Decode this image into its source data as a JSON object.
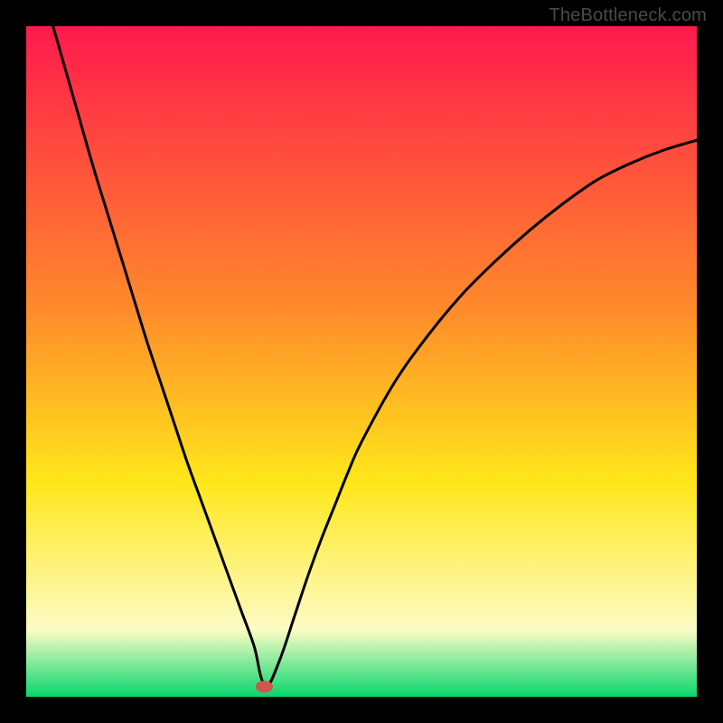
{
  "watermark": "TheBottleneck.com",
  "colors": {
    "grad_top": "#ff1a4d",
    "grad_mid1": "#ff8a2b",
    "grad_mid2": "#ffe71a",
    "grad_mid3": "#fcfcc5",
    "grad_bottom": "#08d66d",
    "curve": "#000000",
    "marker_fill": "#c9594d",
    "bg": "#000000"
  },
  "chart_data": {
    "type": "line",
    "title": "",
    "xlabel": "",
    "ylabel": "",
    "xlim": [
      0,
      100
    ],
    "ylim": [
      0,
      100
    ],
    "series": [
      {
        "name": "bottleneck-curve",
        "x": [
          4,
          6,
          8,
          10,
          12,
          14,
          16,
          18,
          20,
          22,
          24,
          26,
          28,
          30,
          32,
          34,
          35,
          36,
          38,
          40,
          42,
          44,
          46,
          48,
          50,
          55,
          60,
          65,
          70,
          75,
          80,
          85,
          90,
          95,
          100
        ],
        "y": [
          100,
          93,
          86,
          79,
          72.5,
          66,
          59.5,
          53,
          47,
          41,
          35,
          29.5,
          24,
          18.5,
          13,
          7.5,
          3,
          1.5,
          6,
          12,
          18,
          23.5,
          28.5,
          33.5,
          38,
          47,
          54,
          60,
          65,
          69.5,
          73.5,
          77,
          79.5,
          81.5,
          83
        ]
      }
    ],
    "marker": {
      "name": "optimal-point",
      "x": 35.5,
      "y": 1.5,
      "rx_ticks": 1.3,
      "ry_ticks": 0.9
    },
    "grid": false,
    "legend": false
  }
}
